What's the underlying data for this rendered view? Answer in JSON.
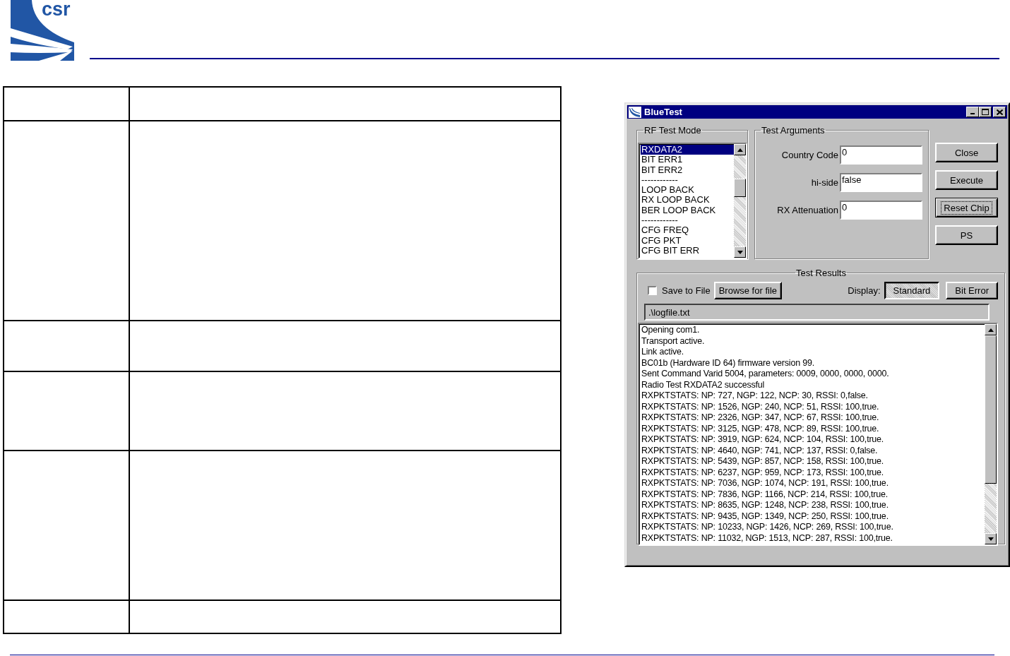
{
  "header": {
    "logo_text": "csr"
  },
  "window": {
    "title": "BlueTest",
    "rf_test_mode": {
      "title": "RF Test Mode",
      "items": [
        {
          "label": "RXDATA2",
          "selected": true
        },
        {
          "label": "BIT ERR1",
          "selected": false
        },
        {
          "label": "BIT ERR2",
          "selected": false
        },
        {
          "label": "------------",
          "selected": false
        },
        {
          "label": "LOOP BACK",
          "selected": false
        },
        {
          "label": "RX LOOP BACK",
          "selected": false
        },
        {
          "label": "BER LOOP BACK",
          "selected": false
        },
        {
          "label": "------------",
          "selected": false
        },
        {
          "label": "CFG FREQ",
          "selected": false
        },
        {
          "label": "CFG PKT",
          "selected": false
        },
        {
          "label": "CFG BIT ERR",
          "selected": false
        }
      ]
    },
    "test_arguments": {
      "title": "Test Arguments",
      "fields": [
        {
          "label": "Country Code",
          "value": "0"
        },
        {
          "label": "hi-side",
          "value": "false"
        },
        {
          "label": "RX Attenuation",
          "value": "0"
        }
      ]
    },
    "buttons": [
      {
        "label": "Close",
        "focused": false
      },
      {
        "label": "Execute",
        "focused": false
      },
      {
        "label": "Reset Chip",
        "focused": true
      },
      {
        "label": "PS",
        "focused": false
      }
    ],
    "test_results": {
      "title": "Test Results",
      "save_to_file": {
        "label": "Save to File",
        "checked": false
      },
      "browse_button": "Browse for file",
      "display_label": "Display:",
      "display_buttons": [
        {
          "label": "Standard",
          "selected": true
        },
        {
          "label": "Bit Error",
          "selected": false
        }
      ],
      "file_path": ".\\logfile.txt",
      "log": [
        "Opening com1.",
        "Transport active.",
        "Link active.",
        "BC01b (Hardware ID 64) firmware version 99.",
        "Sent Command Varid 5004, parameters: 0009, 0000, 0000, 0000.",
        "Radio Test RXDATA2 successful",
        "RXPKTSTATS: NP: 727, NGP: 122, NCP: 30, RSSI: 0,false.",
        "RXPKTSTATS: NP: 1526, NGP: 240, NCP: 51, RSSI: 100,true.",
        "RXPKTSTATS: NP: 2326, NGP: 347, NCP: 67, RSSI: 100,true.",
        "RXPKTSTATS: NP: 3125, NGP: 478, NCP: 89, RSSI: 100,true.",
        "RXPKTSTATS: NP: 3919, NGP: 624, NCP: 104, RSSI: 100,true.",
        "RXPKTSTATS: NP: 4640, NGP: 741, NCP: 137, RSSI: 0,false.",
        "RXPKTSTATS: NP: 5439, NGP: 857, NCP: 158, RSSI: 100,true.",
        "RXPKTSTATS: NP: 6237, NGP: 959, NCP: 173, RSSI: 100,true.",
        "RXPKTSTATS: NP: 7036, NGP: 1074, NCP: 191, RSSI: 100,true.",
        "RXPKTSTATS: NP: 7836, NGP: 1166, NCP: 214, RSSI: 100,true.",
        "RXPKTSTATS: NP: 8635, NGP: 1248, NCP: 238, RSSI: 100,true.",
        "RXPKTSTATS: NP: 9435, NGP: 1349, NCP: 250, RSSI: 100,true.",
        "RXPKTSTATS: NP: 10233, NGP: 1426, NCP: 269, RSSI: 100,true.",
        "RXPKTSTATS: NP: 11032, NGP: 1513, NCP: 287, RSSI: 100,true."
      ]
    }
  }
}
